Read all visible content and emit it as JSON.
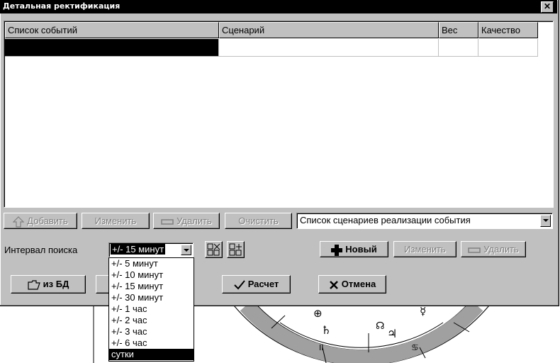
{
  "window": {
    "title": "Детальная ректификация",
    "close_glyph": "✕"
  },
  "grid": {
    "columns": [
      "Список событий",
      "Сценарий",
      "Вес",
      "Качество"
    ],
    "rows": [
      [
        "",
        "",
        "",
        ""
      ]
    ]
  },
  "event_buttons": {
    "add": "Добавить",
    "edit": "Изменить",
    "delete": "Удалить",
    "clear": "Очистить"
  },
  "scenario_combo": {
    "value": "Список сценариев реализации события"
  },
  "search": {
    "label": "Интервал поиска",
    "selected": "+/- 15 минут",
    "options": [
      "+/- 5 минут",
      "+/- 10 минут",
      "+/- 15 минут",
      "+/- 30 минут",
      "+/- 1 час",
      "+/- 2 час",
      "+/- 3 час",
      "+/- 6 час",
      "сутки"
    ],
    "highlighted_index": 8
  },
  "scenario_buttons": {
    "new": "Новый",
    "edit": "Изменить",
    "delete": "Удалить"
  },
  "bottom_buttons": {
    "from_db": "из БД",
    "calculate": "Расчет",
    "cancel": "Отмена"
  },
  "background_chart": {
    "glyphs": {
      "earth": "⊕",
      "mercury": "☿",
      "saturn": "♄",
      "node": "☊",
      "jupiter": "♃",
      "gemini": "II",
      "cancer": "♋"
    }
  }
}
